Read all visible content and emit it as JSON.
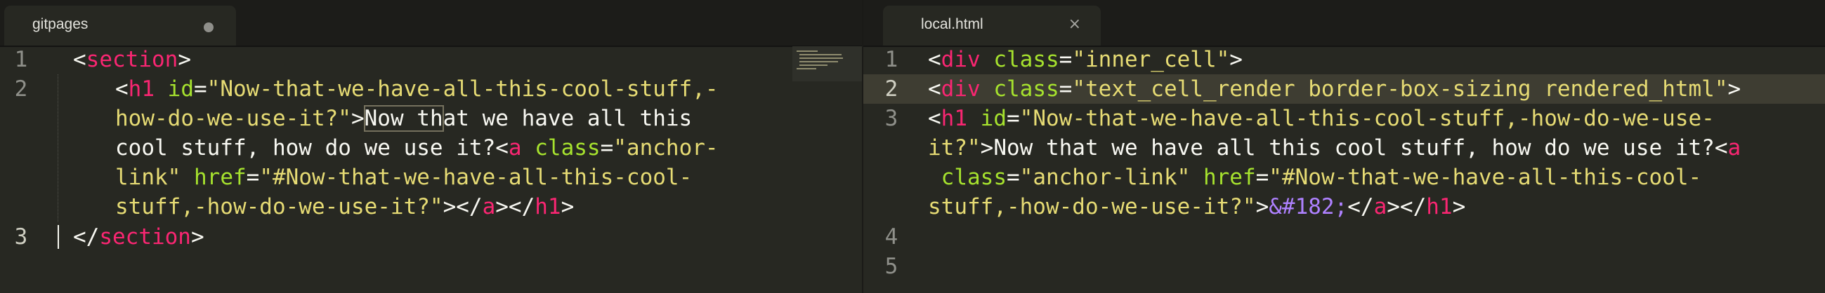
{
  "left_pane": {
    "tab": {
      "title": "gitpages",
      "dirty": true
    },
    "line_numbers": [
      "1",
      "2",
      "3"
    ],
    "lines": {
      "l1": {
        "open": "<",
        "tag": "section",
        "close": ">"
      },
      "l2a": {
        "open": "<",
        "tag": "h1",
        "attr": " id",
        "eq": "=",
        "val": "\"Now-that-we-have-all-this-cool-stuff,-"
      },
      "l2b": {
        "val": "how-do-we-use-it?\"",
        "close": ">",
        "text_a": "Now th",
        "text_b": "at we have all this"
      },
      "l2c": {
        "text": "cool stuff, how do we use it?",
        "open": "<",
        "tag": "a",
        "attr": " class",
        "eq": "=",
        "val": "\"anchor-"
      },
      "l2d": {
        "val": "link\"",
        "attr": " href",
        "eq": "=",
        "val2": "\"#Now-that-we-have-all-this-cool-"
      },
      "l2e": {
        "val": "stuff,-how-do-we-use-it?\"",
        "gt": ">",
        "lt1": "</",
        "tag1": "a",
        "mid": "></",
        "tag2": "h1",
        "close": ">"
      },
      "l3": {
        "open": "</",
        "tag": "section",
        "close": ">"
      }
    }
  },
  "right_pane": {
    "tab": {
      "title": "local.html",
      "close_icon": "×"
    },
    "line_numbers": [
      "1",
      "2",
      "3",
      "4",
      "5"
    ],
    "lines": {
      "l1": {
        "open": "<",
        "tag": "div",
        "attr": " class",
        "eq": "=",
        "val": "\"inner_cell\"",
        "close": ">"
      },
      "l2": {
        "open": "<",
        "tag": "div",
        "attr": " class",
        "eq": "=",
        "val": "\"text_cell_render border-box-sizing rendered_html\"",
        "close": ">"
      },
      "l3a": {
        "open": "<",
        "tag": "h1",
        "attr": " id",
        "eq": "=",
        "val": "\"Now-that-we-have-all-this-cool-stuff,-how-do-we-use-"
      },
      "l3b": {
        "val": "it?\"",
        "gt": ">",
        "text": "Now that we have all this cool stuff, how do we use it?",
        "open": "<",
        "tag": "a"
      },
      "l3c": {
        "attr": " class",
        "eq": "=",
        "val": "\"anchor-link\"",
        "attr2": " href",
        "eq2": "=",
        "val2": "\"#Now-that-we-have-all-this-cool-"
      },
      "l3d": {
        "val": "stuff,-how-do-we-use-it?\"",
        "gt": ">",
        "entity": "&#182;",
        "lt1": "</",
        "tag1": "a",
        "mid": "></",
        "tag2": "h1",
        "close": ">"
      }
    }
  },
  "colors": {
    "background": "#272822",
    "tag": "#f92672",
    "attribute": "#a6e22e",
    "string": "#e6db74",
    "entity": "#ae81ff",
    "text": "#f8f8f2"
  }
}
